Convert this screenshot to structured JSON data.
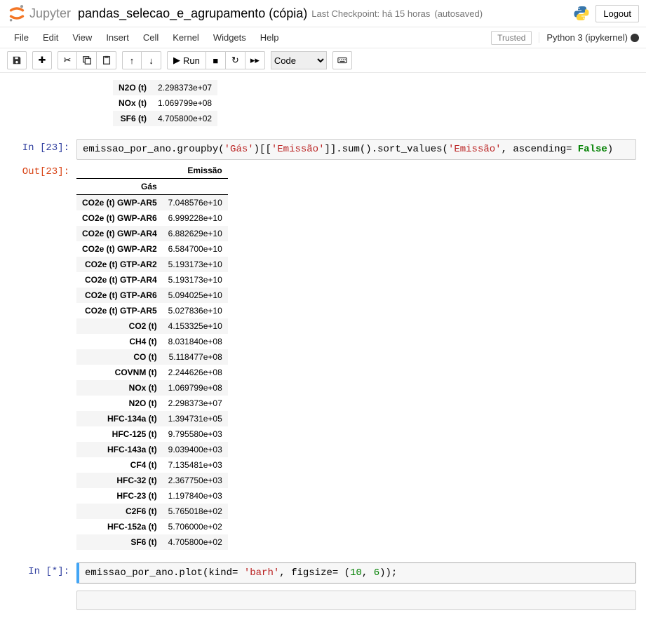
{
  "header": {
    "logo_text": "Jupyter",
    "nb_title": "pandas_selecao_e_agrupamento (cópia)",
    "checkpoint": "Last Checkpoint: há 15 horas",
    "autosave": "(autosaved)",
    "logout": "Logout"
  },
  "menubar": {
    "items": [
      "File",
      "Edit",
      "View",
      "Insert",
      "Cell",
      "Kernel",
      "Widgets",
      "Help"
    ],
    "trusted": "Trusted",
    "kernel": "Python 3 (ipykernel)"
  },
  "toolbar": {
    "run_label": "Run",
    "cell_type": "Code"
  },
  "top_rows": [
    {
      "label": "N2O (t)",
      "value": "2.298373e+07"
    },
    {
      "label": "NOx (t)",
      "value": "1.069799e+08"
    },
    {
      "label": "SF6 (t)",
      "value": "4.705800e+02"
    }
  ],
  "cell23": {
    "in_prompt": "In [23]:",
    "out_prompt": "Out[23]:",
    "code_parts": {
      "p1": "emissao_por_ano.groupby(",
      "s1": "'Gás'",
      "p2": ")[[",
      "s2": "'Emissão'",
      "p3": "]].sum().sort_values(",
      "s3": "'Emissão'",
      "p4": ", ascending= ",
      "kw": "False",
      "p5": ")"
    },
    "col_header": "Emissão",
    "index_name": "Gás",
    "rows": [
      {
        "label": "CO2e (t) GWP-AR5",
        "value": "7.048576e+10"
      },
      {
        "label": "CO2e (t) GWP-AR6",
        "value": "6.999228e+10"
      },
      {
        "label": "CO2e (t) GWP-AR4",
        "value": "6.882629e+10"
      },
      {
        "label": "CO2e (t) GWP-AR2",
        "value": "6.584700e+10"
      },
      {
        "label": "CO2e (t) GTP-AR2",
        "value": "5.193173e+10"
      },
      {
        "label": "CO2e (t) GTP-AR4",
        "value": "5.193173e+10"
      },
      {
        "label": "CO2e (t) GTP-AR6",
        "value": "5.094025e+10"
      },
      {
        "label": "CO2e (t) GTP-AR5",
        "value": "5.027836e+10"
      },
      {
        "label": "CO2 (t)",
        "value": "4.153325e+10"
      },
      {
        "label": "CH4 (t)",
        "value": "8.031840e+08"
      },
      {
        "label": "CO (t)",
        "value": "5.118477e+08"
      },
      {
        "label": "COVNM (t)",
        "value": "2.244626e+08"
      },
      {
        "label": "NOx (t)",
        "value": "1.069799e+08"
      },
      {
        "label": "N2O (t)",
        "value": "2.298373e+07"
      },
      {
        "label": "HFC-134a (t)",
        "value": "1.394731e+05"
      },
      {
        "label": "HFC-125 (t)",
        "value": "9.795580e+03"
      },
      {
        "label": "HFC-143a (t)",
        "value": "9.039400e+03"
      },
      {
        "label": "CF4 (t)",
        "value": "7.135481e+03"
      },
      {
        "label": "HFC-32 (t)",
        "value": "2.367750e+03"
      },
      {
        "label": "HFC-23 (t)",
        "value": "1.197840e+03"
      },
      {
        "label": "C2F6 (t)",
        "value": "5.765018e+02"
      },
      {
        "label": "HFC-152a (t)",
        "value": "5.706000e+02"
      },
      {
        "label": "SF6 (t)",
        "value": "4.705800e+02"
      }
    ]
  },
  "cell_running": {
    "in_prompt": "In [*]:",
    "code_parts": {
      "p1": "emissao_por_ano.plot(kind= ",
      "s1": "'barh'",
      "p2": ", figsize= (",
      "n1": "10",
      "p3": ", ",
      "n2": "6",
      "p4": "));"
    }
  }
}
